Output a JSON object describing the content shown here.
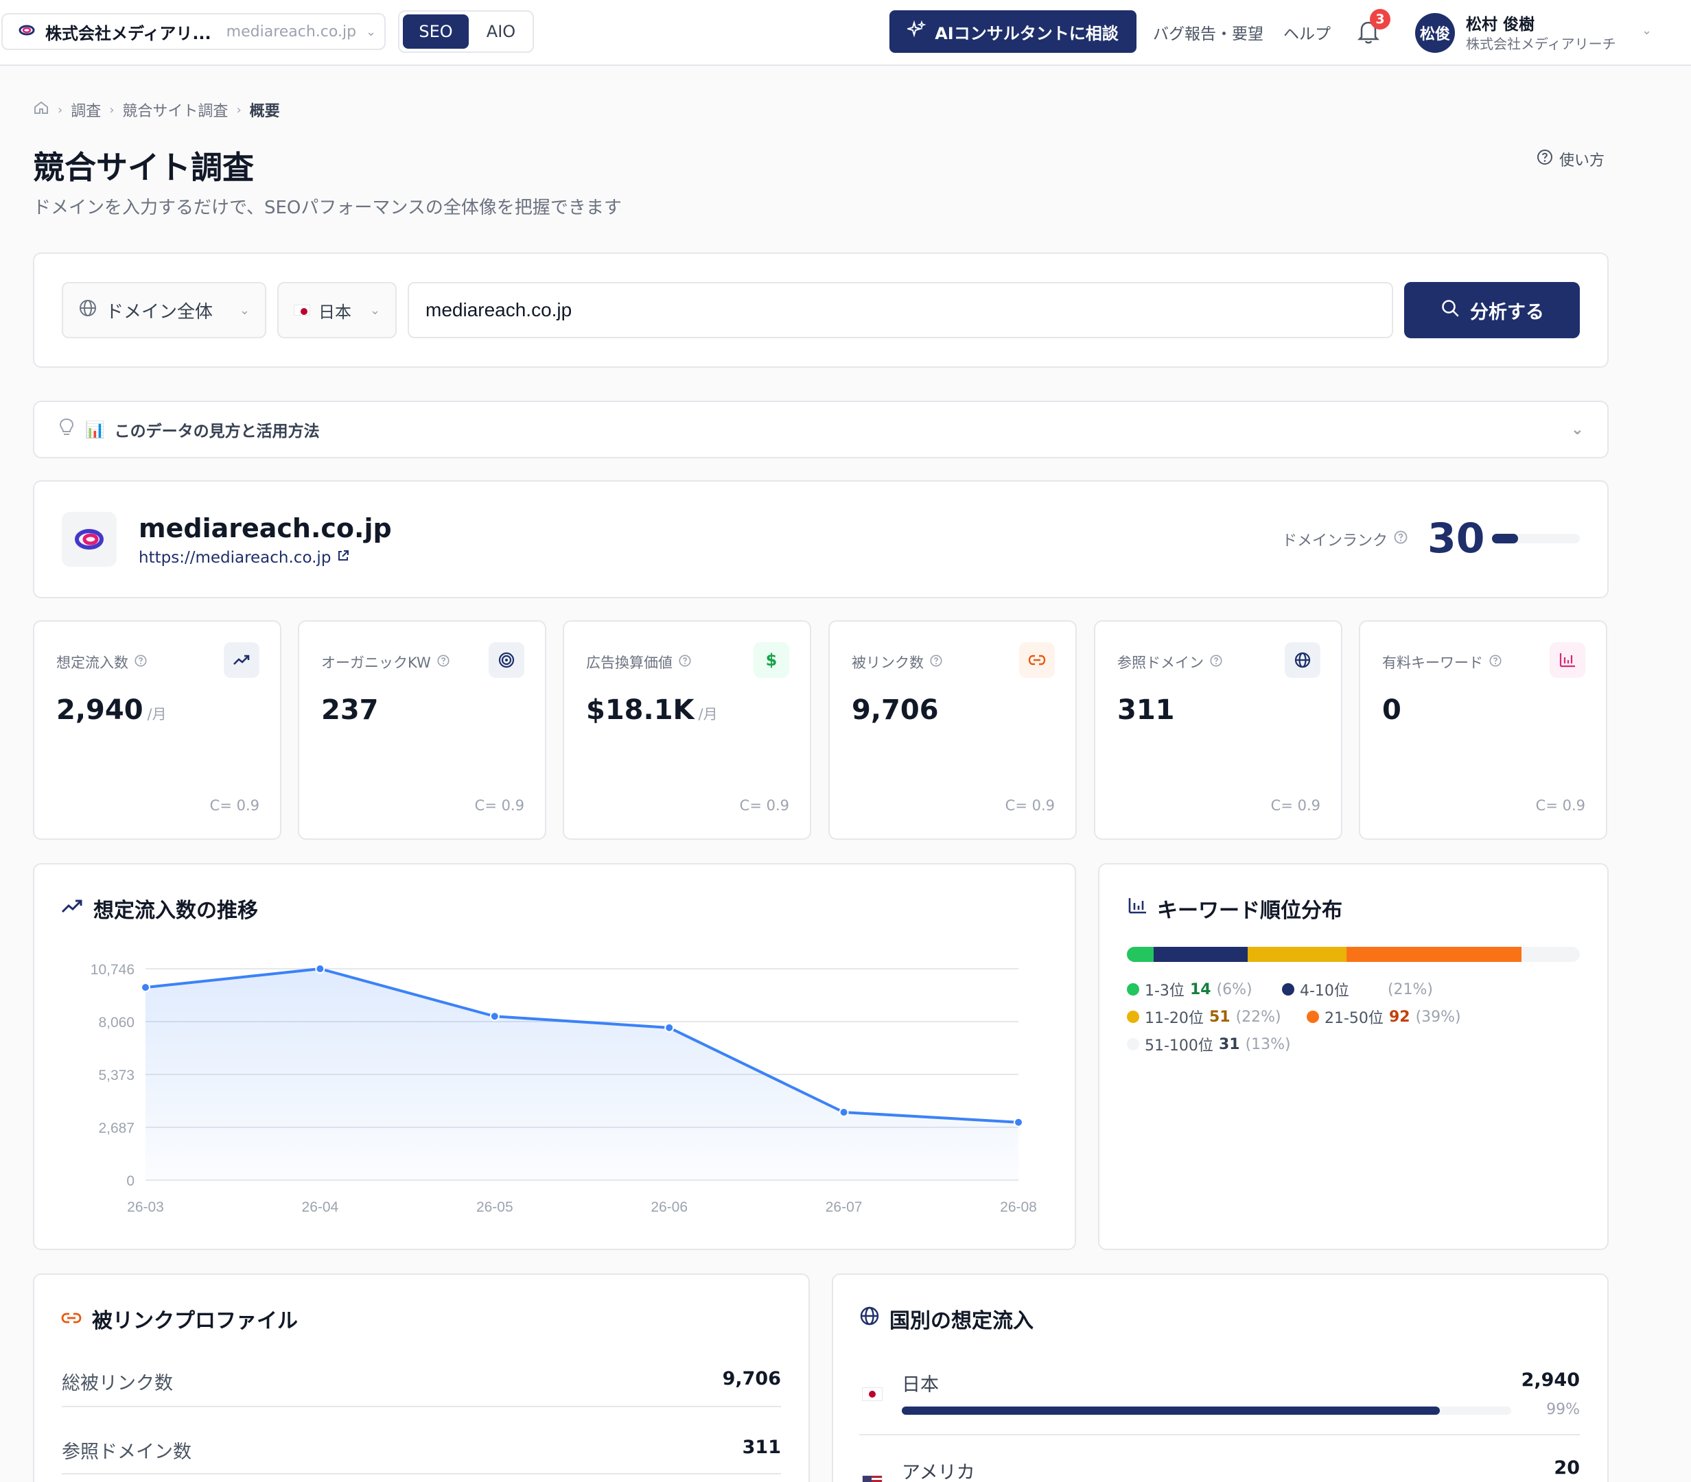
{
  "topbar": {
    "company": "株式会社メディアリ...",
    "company_domain": "mediareach.co.jp",
    "mode_seo": "SEO",
    "mode_aio": "AIO",
    "ai_button": "AIコンサルタントに相談",
    "bug_report": "バグ報告・要望",
    "help": "ヘルプ",
    "notification_count": "3",
    "avatar_initials": "松俊",
    "user_name": "松村 俊樹",
    "user_org": "株式会社メディアリーチ"
  },
  "breadcrumb": {
    "items": [
      "調査",
      "競合サイト調査",
      "概要"
    ]
  },
  "header": {
    "title": "競合サイト調査",
    "subtitle": "ドメインを入力するだけで、SEOパフォーマンスの全体像を把握できます",
    "howto": "使い方"
  },
  "search": {
    "scope": "ドメイン全体",
    "country": "日本",
    "domain_value": "mediareach.co.jp",
    "analyze_button": "分析する"
  },
  "tips": {
    "label": "このデータの見方と活用方法",
    "emoji": "📊"
  },
  "domain": {
    "name": "mediareach.co.jp",
    "url": "https://mediareach.co.jp",
    "rank_label": "ドメインランク",
    "rank_value": "30",
    "rank_fraction": 0.3
  },
  "metrics": [
    {
      "label": "想定流入数",
      "value": "2,940",
      "unit": "/月",
      "conf": "C= 0.9",
      "icon": "trending-up-icon",
      "color": "#1e2f6b",
      "bg": "#eef2f7"
    },
    {
      "label": "オーガニックKW",
      "value": "237",
      "unit": "",
      "conf": "C= 0.9",
      "icon": "target-icon",
      "color": "#1e2f6b",
      "bg": "#eef2f7"
    },
    {
      "label": "広告換算価値",
      "value": "$18.1K",
      "unit": "/月",
      "conf": "C= 0.9",
      "icon": "dollar-icon",
      "color": "#16a34a",
      "bg": "#ecfdf3"
    },
    {
      "label": "被リンク数",
      "value": "9,706",
      "unit": "",
      "conf": "C= 0.9",
      "icon": "link-icon",
      "color": "#ea580c",
      "bg": "#fff4ec"
    },
    {
      "label": "参照ドメイン",
      "value": "311",
      "unit": "",
      "conf": "C= 0.9",
      "icon": "globe-icon",
      "color": "#1e2f6b",
      "bg": "#eef2f7"
    },
    {
      "label": "有料キーワード",
      "value": "0",
      "unit": "",
      "conf": "C= 0.9",
      "icon": "bar-chart-icon",
      "color": "#db2777",
      "bg": "#fdf0f6"
    }
  ],
  "trend": {
    "title": "想定流入数の推移"
  },
  "chart_data": {
    "type": "area",
    "title": "想定流入数の推移",
    "x": [
      "26-03",
      "26-04",
      "26-05",
      "26-06",
      "26-07",
      "26-08"
    ],
    "values": [
      9800,
      10746,
      8330,
      7750,
      3450,
      2940
    ],
    "yticks": [
      0,
      2687,
      5373,
      8060,
      10746
    ],
    "ytick_labels": [
      "0",
      "2,687",
      "5,373",
      "8,060",
      "10,746"
    ],
    "ylim": [
      0,
      10746
    ],
    "grid": true,
    "line_color": "#3b82f6"
  },
  "keywords": {
    "title": "キーワード順位分布",
    "segments": [
      {
        "label": "1-3位",
        "count": "14",
        "pct": "(6%)",
        "share": 6,
        "color": "#22c55e",
        "count_color": "#15803d"
      },
      {
        "label": "4-10位",
        "count": "",
        "pct": "(21%)",
        "share": 21,
        "color": "#1e2f6b",
        "count_color": "#1e2f6b"
      },
      {
        "label": "11-20位",
        "count": "51",
        "pct": "(22%)",
        "share": 22,
        "color": "#eab308",
        "count_color": "#a16207"
      },
      {
        "label": "21-50位",
        "count": "92",
        "pct": "(39%)",
        "share": 39,
        "color": "#f97316",
        "count_color": "#c2410c"
      },
      {
        "label": "51-100位",
        "count": "31",
        "pct": "(13%)",
        "share": 13,
        "color": "#f3f4f6",
        "count_color": "#374151"
      }
    ]
  },
  "backlinks": {
    "title": "被リンクプロファイル",
    "rows": [
      {
        "label": "総被リンク数",
        "value": "9,706"
      },
      {
        "label": "参照ドメイン数",
        "value": "311"
      }
    ]
  },
  "countries": {
    "title": "国別の想定流入",
    "rows": [
      {
        "name": "日本",
        "value": "2,940",
        "pct": "99%",
        "share": 0.99
      },
      {
        "name": "アメリカ",
        "value": "20",
        "pct": "",
        "share": 0.01
      }
    ]
  }
}
